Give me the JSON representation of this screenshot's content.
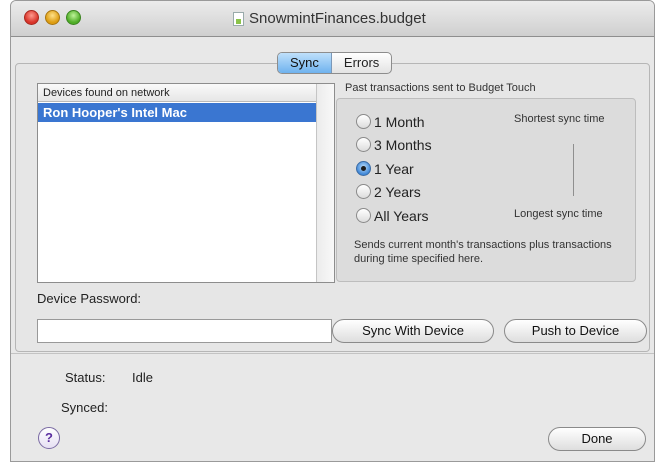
{
  "window": {
    "title": "SnowmintFinances.budget"
  },
  "tabs": [
    {
      "label": "Sync",
      "active": true
    },
    {
      "label": "Errors",
      "active": false
    }
  ],
  "devices": {
    "header": "Devices found on network",
    "items": [
      "Ron Hooper's Intel Mac"
    ],
    "selected_index": 0
  },
  "past_transactions": {
    "caption": "Past transactions sent to Budget Touch",
    "options": [
      "1 Month",
      "3 Months",
      "1 Year",
      "2 Years",
      "All Years"
    ],
    "selected": "1 Year",
    "shortest_label": "Shortest sync time",
    "longest_label": "Longest sync time",
    "note": "Sends current month's transactions plus transactions during time specified here."
  },
  "password": {
    "label": "Device Password:",
    "value": ""
  },
  "buttons": {
    "sync_with_device": "Sync With Device",
    "push_to_device": "Push to Device",
    "done": "Done"
  },
  "status": {
    "status_label": "Status:",
    "status_value": "Idle",
    "synced_label": "Synced:",
    "synced_value": ""
  },
  "help": {
    "glyph": "?"
  },
  "colors": {
    "selection": "#3a76d1",
    "tab_active": "#6fb2ee"
  }
}
